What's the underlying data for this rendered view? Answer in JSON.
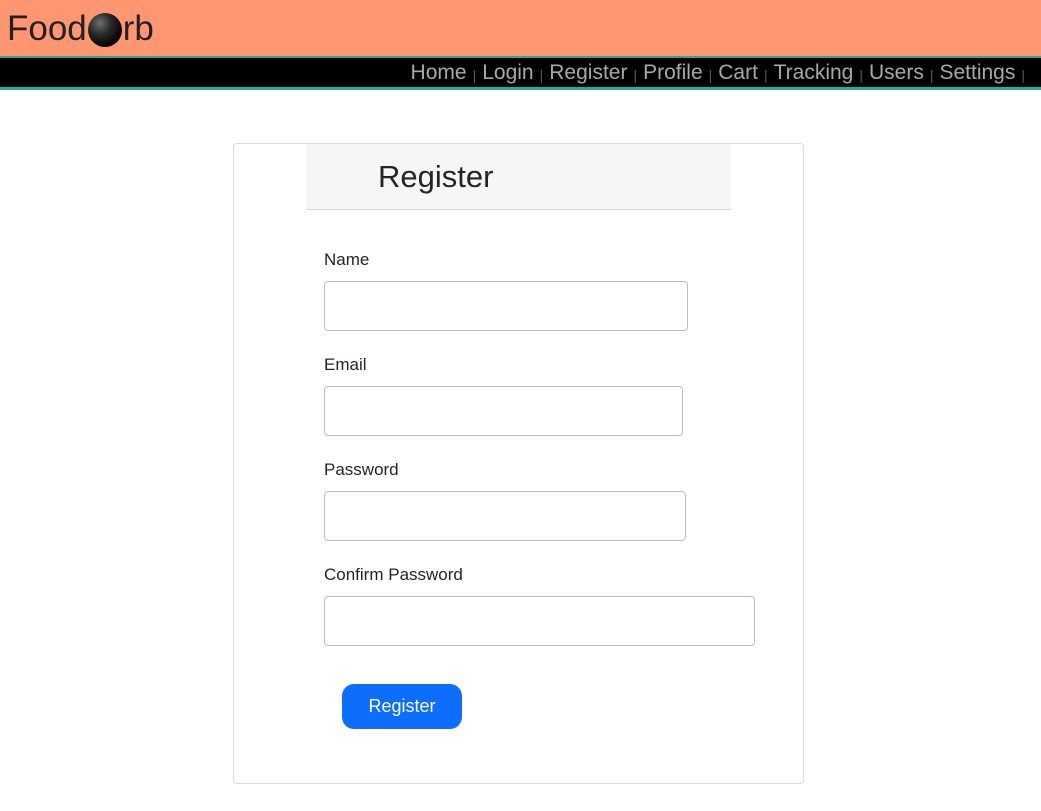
{
  "brand": {
    "logo_prefix": "Food",
    "logo_suffix": "rb",
    "logo_icon": "orb-icon",
    "bar_color": "#ff9672"
  },
  "nav": {
    "items": [
      {
        "label": "Home"
      },
      {
        "label": "Login"
      },
      {
        "label": "Register"
      },
      {
        "label": "Profile"
      },
      {
        "label": "Cart"
      },
      {
        "label": "Tracking"
      },
      {
        "label": "Users"
      },
      {
        "label": "Settings"
      }
    ],
    "separator": "|",
    "accent_color": "#2aa99a"
  },
  "register_form": {
    "title": "Register",
    "fields": {
      "name": {
        "label": "Name",
        "value": "",
        "placeholder": ""
      },
      "email": {
        "label": "Email",
        "value": "",
        "placeholder": ""
      },
      "password": {
        "label": "Password",
        "value": "",
        "placeholder": ""
      },
      "confirm_password": {
        "label": "Confirm Password",
        "value": "",
        "placeholder": ""
      }
    },
    "submit_label": "Register",
    "submit_color": "#0d6efd"
  }
}
